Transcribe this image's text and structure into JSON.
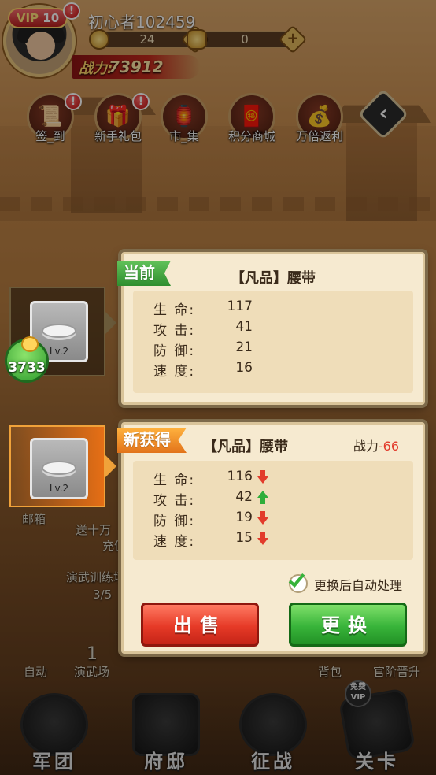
{
  "player": {
    "vip_prefix": "VIP",
    "vip_level": "10",
    "name": "初心者102459",
    "currency_1": "24",
    "currency_2": "0",
    "power_label": "战力:",
    "power_value": "73912",
    "vip_alert": "!"
  },
  "activities": [
    {
      "label": "签_到",
      "icon": "scroll-icon",
      "alert": "!"
    },
    {
      "label": "新手礼包",
      "icon": "gift-box-icon",
      "alert": "!"
    },
    {
      "label": "市_集",
      "icon": "market-icon",
      "alert": ""
    },
    {
      "label": "积分商城",
      "icon": "points-shop-icon",
      "alert": ""
    },
    {
      "label": "万倍返利",
      "icon": "rebate-coins-icon",
      "alert": ""
    }
  ],
  "collapse_glyph": "‹",
  "gift_bubble_value": "3733",
  "current_item": {
    "tag": "当前",
    "title": "【凡品】腰带",
    "level": "Lv.2",
    "stats": [
      {
        "key": "生 命:",
        "value": "117"
      },
      {
        "key": "攻 击:",
        "value": "41"
      },
      {
        "key": "防 御:",
        "value": "21"
      },
      {
        "key": "速 度:",
        "value": "16"
      }
    ]
  },
  "new_item": {
    "tag": "新获得",
    "title": "【凡品】腰带",
    "level": "Lv.2",
    "power_label": "战力",
    "power_diff": "-66",
    "stats": [
      {
        "key": "生 命:",
        "value": "116",
        "trend": "down"
      },
      {
        "key": "攻 击:",
        "value": "42",
        "trend": "up"
      },
      {
        "key": "防 御:",
        "value": "19",
        "trend": "down"
      },
      {
        "key": "速 度:",
        "value": "15",
        "trend": "down"
      }
    ],
    "auto_process_label": "更换后自动处理",
    "auto_process_checked": true,
    "sell_label": "出售",
    "replace_label": "更换"
  },
  "background_text": {
    "mail": "邮箱",
    "activity_fragment": "送十万",
    "recharge_fragment": "充值",
    "training": "演武训练场",
    "training_progress": "3/5",
    "auto": "自动",
    "drill_hall": "演武场",
    "drill_count": "1",
    "bag": "背包",
    "promotion": "官阶晋升"
  },
  "bottom_nav": [
    {
      "label": "军团",
      "icon": "legion-helmet-icon"
    },
    {
      "label": "府邸",
      "icon": "mansion-icon"
    },
    {
      "label": "征战",
      "icon": "war-drum-icon"
    },
    {
      "label": "关卡",
      "icon": "stage-weapons-icon"
    }
  ],
  "vip_free_badge": {
    "line1": "免费",
    "line2": "VIP"
  },
  "colors": {
    "sell_button": "#e63a27",
    "replace_button": "#38b43a",
    "current_tag": "#3fa33a",
    "new_tag": "#f0911f",
    "negative": "#e23b2b",
    "positive": "#2fae3a"
  }
}
